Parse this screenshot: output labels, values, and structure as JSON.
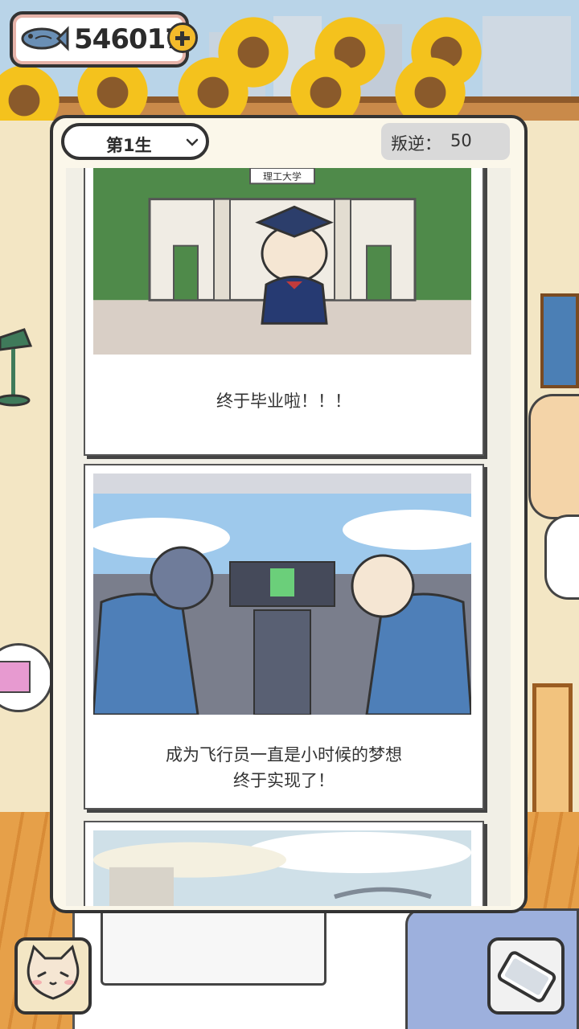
{
  "currency": {
    "value": "546017",
    "icon": "fish-icon",
    "add_icon": "plus-icon"
  },
  "life_select": {
    "selected": "第1生"
  },
  "rebel": {
    "label": "叛逆：",
    "value": "50"
  },
  "cards": [
    {
      "caption": "终于毕业啦！！！",
      "sign": "理工大学"
    },
    {
      "caption_line1": "成为飞行员一直是小时候的梦想",
      "caption_line2": "终于实现了！"
    },
    {
      "caption": ""
    }
  ],
  "bottom": {
    "left_icon": "cat-face-icon",
    "right_icon": "phone-icon"
  },
  "colors": {
    "panel_bg": "#fbf7ea",
    "border": "#333333",
    "coin_plus": "#f3bb2b",
    "select_bg": "#ffffff",
    "rebel_bg": "#d9d9d9"
  }
}
